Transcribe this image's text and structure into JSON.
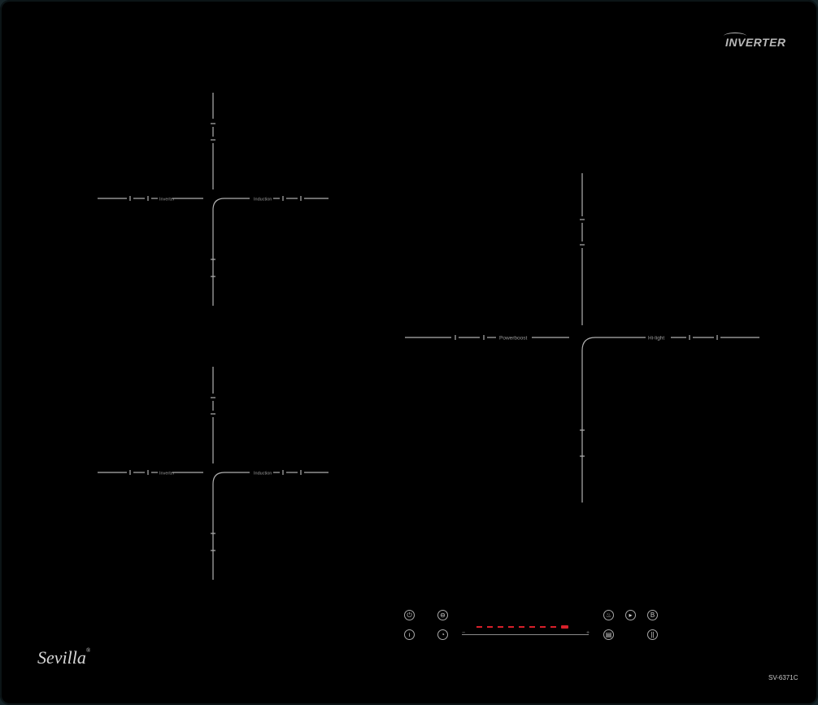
{
  "brand": {
    "inverter_logo": "INVERTER",
    "sevilla_logo": "Sevilla",
    "registered_mark": "®",
    "model": "SV-6371C"
  },
  "zones": {
    "top_left": {
      "left_label": "Inverter",
      "right_label": "Induction"
    },
    "bottom_left": {
      "left_label": "Inverter",
      "right_label": "Induction"
    },
    "right": {
      "left_label": "Powerboost",
      "right_label": "Hi-light"
    }
  },
  "controls": {
    "power_icon": "power-icon",
    "timer_icon": "timer-icon",
    "lock_icon": "child-lock-icon",
    "clock_icon": "clock-icon",
    "pot_icon": "pot-icon",
    "play_pause_icon": "play-pause-icon",
    "boost_label": "B",
    "keep_warm_icon": "keep-warm-icon",
    "pause_label": "||"
  },
  "slider": {
    "active_segments": 9,
    "segment_color": "#d8202a",
    "min_label": "−",
    "max_label": "+"
  },
  "colors": {
    "surface": "#000000",
    "frame": "#162428",
    "marking": "#b0b0b0",
    "indicator": "#d8202a"
  }
}
